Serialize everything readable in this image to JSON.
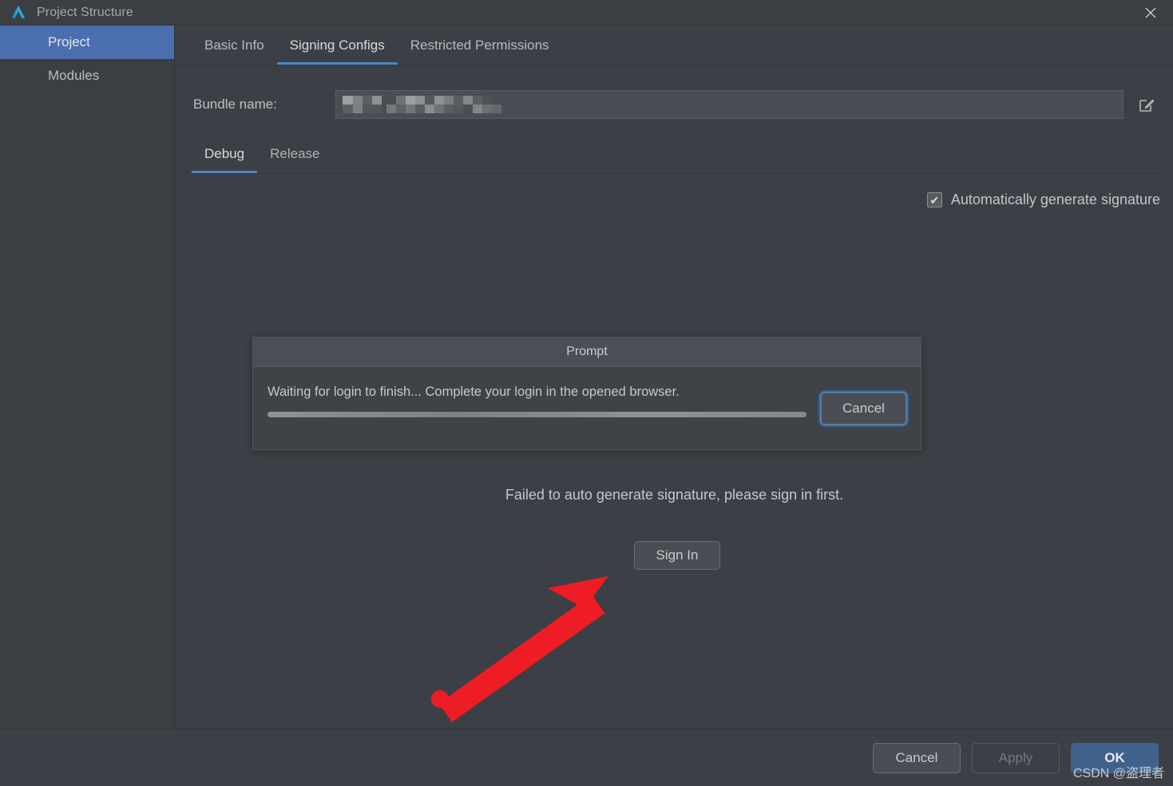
{
  "window": {
    "title": "Project Structure",
    "logo_icon": "deveco-logo-icon",
    "close_icon": "close-icon"
  },
  "sidebar": {
    "items": [
      {
        "label": "Project",
        "selected": true
      },
      {
        "label": "Modules",
        "selected": false
      }
    ]
  },
  "tabs": [
    {
      "label": "Basic Info",
      "active": false
    },
    {
      "label": "Signing Configs",
      "active": true
    },
    {
      "label": "Restricted Permissions",
      "active": false
    }
  ],
  "bundle": {
    "label": "Bundle name:",
    "value": "",
    "placeholder": "",
    "redacted": true,
    "edit_icon": "edit-pencil-icon"
  },
  "build_variants": [
    {
      "label": "Debug",
      "active": true
    },
    {
      "label": "Release",
      "active": false
    }
  ],
  "auto_generate": {
    "label": "Automatically generate signature",
    "checked": true,
    "check_glyph": "✔"
  },
  "prompt_dialog": {
    "title": "Prompt",
    "message": "Waiting for login to finish... Complete your login in the opened browser.",
    "progress_percent": 100,
    "progress_indeterminate": true,
    "cancel_label": "Cancel"
  },
  "status": {
    "failure_message": "Failed to auto generate signature, please sign in first.",
    "sign_in_label": "Sign In"
  },
  "annotation": {
    "type": "red-arrow",
    "color": "#ee1c25",
    "points_to": "sign-in-button"
  },
  "footer": {
    "cancel_label": "Cancel",
    "apply_label": "Apply",
    "apply_disabled": true,
    "ok_label": "OK"
  },
  "watermark": {
    "text": "CSDN @盗理者"
  },
  "colors": {
    "accent_blue": "#4a88c7",
    "selection_blue": "#4b6eaf",
    "primary_button": "#41618d",
    "window_bg": "#3c3f45",
    "sidebar_bg": "#3b3e42",
    "arrow_red": "#ee1c25"
  }
}
